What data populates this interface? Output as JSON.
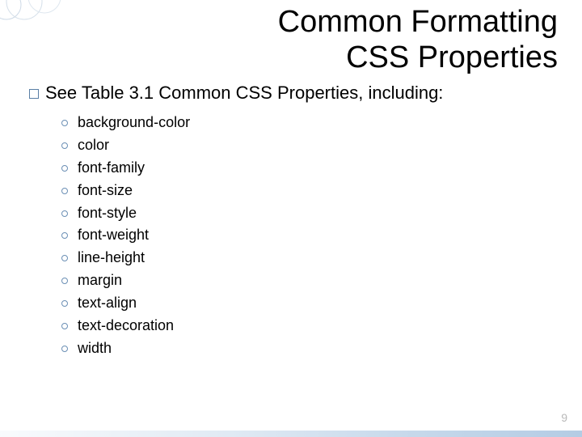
{
  "title": "Common Formatting\nCSS Properties",
  "intro": "See Table 3.1 Common CSS Properties, including:",
  "items": [
    "background-color",
    "color",
    "font-family",
    "font-size",
    "font-style",
    "font-weight",
    "line-height",
    "margin",
    "text-align",
    "text-decoration",
    "width"
  ],
  "page": "9"
}
